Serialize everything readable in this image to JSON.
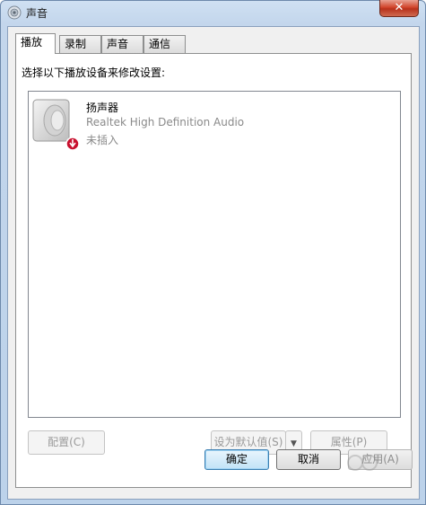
{
  "window": {
    "title": "声音",
    "close_label": "✕"
  },
  "tabs": [
    {
      "label": "播放",
      "active": true
    },
    {
      "label": "录制",
      "active": false
    },
    {
      "label": "声音",
      "active": false
    },
    {
      "label": "通信",
      "active": false
    }
  ],
  "panel": {
    "instruction": "选择以下播放设备来修改设置:",
    "devices": [
      {
        "name": "扬声器",
        "description": "Realtek High Definition Audio",
        "status": "未插入",
        "icon": "speaker-icon"
      }
    ],
    "buttons": {
      "configure": "配置(C)",
      "set_default": "设为默认值(S)",
      "set_default_arrow": "▼",
      "properties": "属性(P)"
    }
  },
  "dialog_buttons": {
    "ok": "确定",
    "cancel": "取消",
    "apply": "应用(A)"
  },
  "colors": {
    "accent": "#3c7fb1",
    "close": "#d1452c",
    "status_badge": "#c8102e"
  }
}
